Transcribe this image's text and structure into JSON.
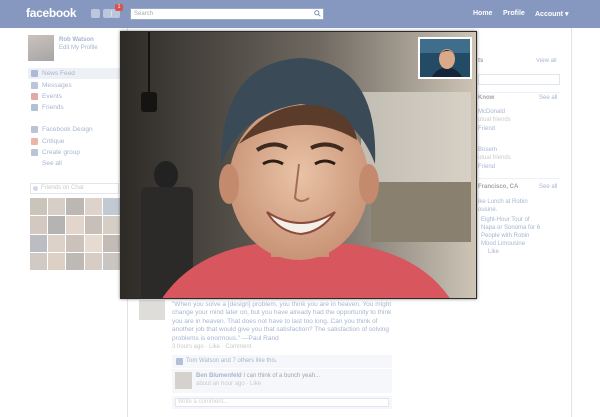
{
  "topbar": {
    "logo": "facebook",
    "notification_count": "1",
    "search_placeholder": "Search",
    "nav": [
      "Home",
      "Profile",
      "Account ▾"
    ]
  },
  "profile": {
    "name": "Rob Watson",
    "edit": "Edit My Profile"
  },
  "sidebar": {
    "items": [
      {
        "label": "News Feed",
        "icon": "news-feed-icon",
        "color": "#4a67a8"
      },
      {
        "label": "Messages",
        "icon": "messages-icon",
        "color": "#6a7fb0"
      },
      {
        "label": "Events",
        "icon": "events-icon",
        "color": "#c0423a"
      },
      {
        "label": "Friends",
        "icon": "friends-icon",
        "color": "#5573a8"
      },
      {
        "label": "Facebook Design",
        "icon": "group-icon",
        "color": "#6b7d9e"
      },
      {
        "label": "Critique",
        "icon": "critique-icon",
        "color": "#d35b3e"
      },
      {
        "label": "Create group",
        "icon": "create-group-icon",
        "color": "#6b7d9e"
      }
    ],
    "see_all": "See all",
    "chat_search_placeholder": "Friends on Chat"
  },
  "right_column": {
    "section1": {
      "head": "ts",
      "see_all": "View all"
    },
    "section2": {
      "head": "Know",
      "see_all": "See all",
      "people": [
        {
          "name": "McDonald",
          "sub": "utual friends"
        },
        {
          "name": "Friend",
          "sub": ""
        },
        {
          "name": "Bosern",
          "sub": "utual friends"
        },
        {
          "name": "Friend",
          "sub": ""
        }
      ]
    },
    "section3": {
      "head": "Francisco, CA",
      "see_all": "See all",
      "lines": [
        "ike Lunch at Robin",
        "ousine.",
        "Eight-Hour Tour of",
        "Napa or Sonoma for 6",
        "People with Robin",
        "Mood Limousine",
        "Like"
      ]
    }
  },
  "feed": {
    "quote": "\"When you solve a [design] problem, you think you are in heaven. You might change your mind later on, but you have already had the opportunity to think you are in heaven. That does not have to last too long. Can you think of another job that would give you that satisfaction? The satisfaction of solving problems is enormous.\" —Paul Rand",
    "meta": "3 hours ago · Like · Comment",
    "likes_name": "Tom Watson",
    "likes_rest": " and ",
    "likes_others": "7 others",
    "likes_tail": " like this.",
    "comment_author": "Ben Blumenfeld",
    "comment_text": " I can think of a bunch yeah...",
    "comment_meta": "about an hour ago · Like",
    "write_placeholder": "Write a comment..."
  },
  "video_call": {
    "main_video": "video-call-main",
    "self_view": "video-call-self-view"
  }
}
